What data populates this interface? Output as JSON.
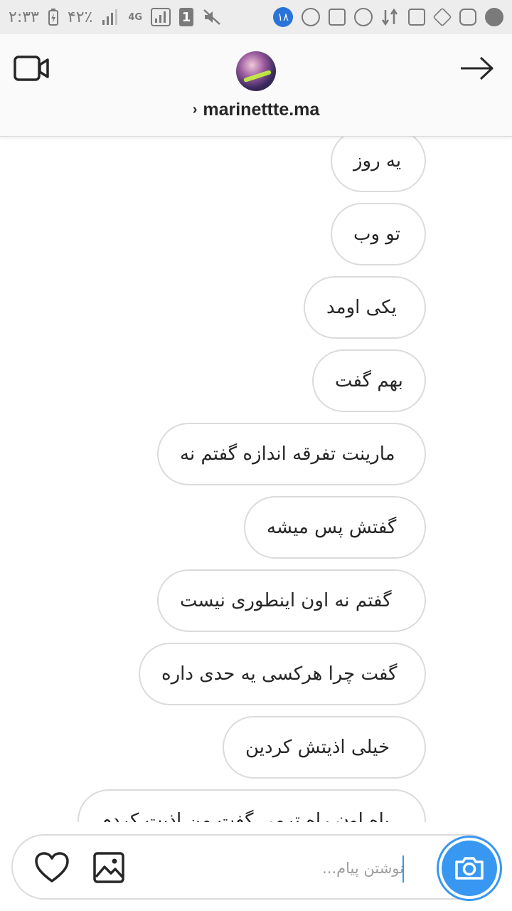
{
  "status_bar": {
    "time": "۲:۳۳",
    "battery": "۴۲٪",
    "network": "4G",
    "sim_slot": "1",
    "notification_count": "۱۸"
  },
  "header": {
    "chevron": "›",
    "username": "marinettte.ma"
  },
  "messages": [
    {
      "text": "یه روز",
      "width": 134
    },
    {
      "text": "تو وب",
      "width": 134
    },
    {
      "text": "یکی اومد",
      "width": 172
    },
    {
      "text": "بهم گفت",
      "width": 160
    },
    {
      "text": "مارینت تفرقه اندازه گفتم نه",
      "width": 378
    },
    {
      "text": "گفتش پس میشه",
      "width": 256
    },
    {
      "text": "گفتم نه اون اینطوری نیست",
      "width": 378
    },
    {
      "text": "گفت چرا هرکسی یه حدی داره",
      "width": 404
    },
    {
      "text": "خیلی اذیتش کردین",
      "width": 286
    },
    {
      "text": "باه اون راه ترمی گفت من اذیت کردم",
      "width": 490
    }
  ],
  "composer": {
    "placeholder": "نوشتن پیام...",
    "value": ""
  },
  "colors": {
    "accent": "#3897f0",
    "bubble_border": "#dbdbdb",
    "text": "#262626",
    "status_bar_bg": "#ededed",
    "notification_badge": "#2a73d8"
  },
  "icons": [
    "video-call-icon",
    "forward-arrow-icon",
    "heart-icon",
    "gallery-icon",
    "camera-icon"
  ]
}
